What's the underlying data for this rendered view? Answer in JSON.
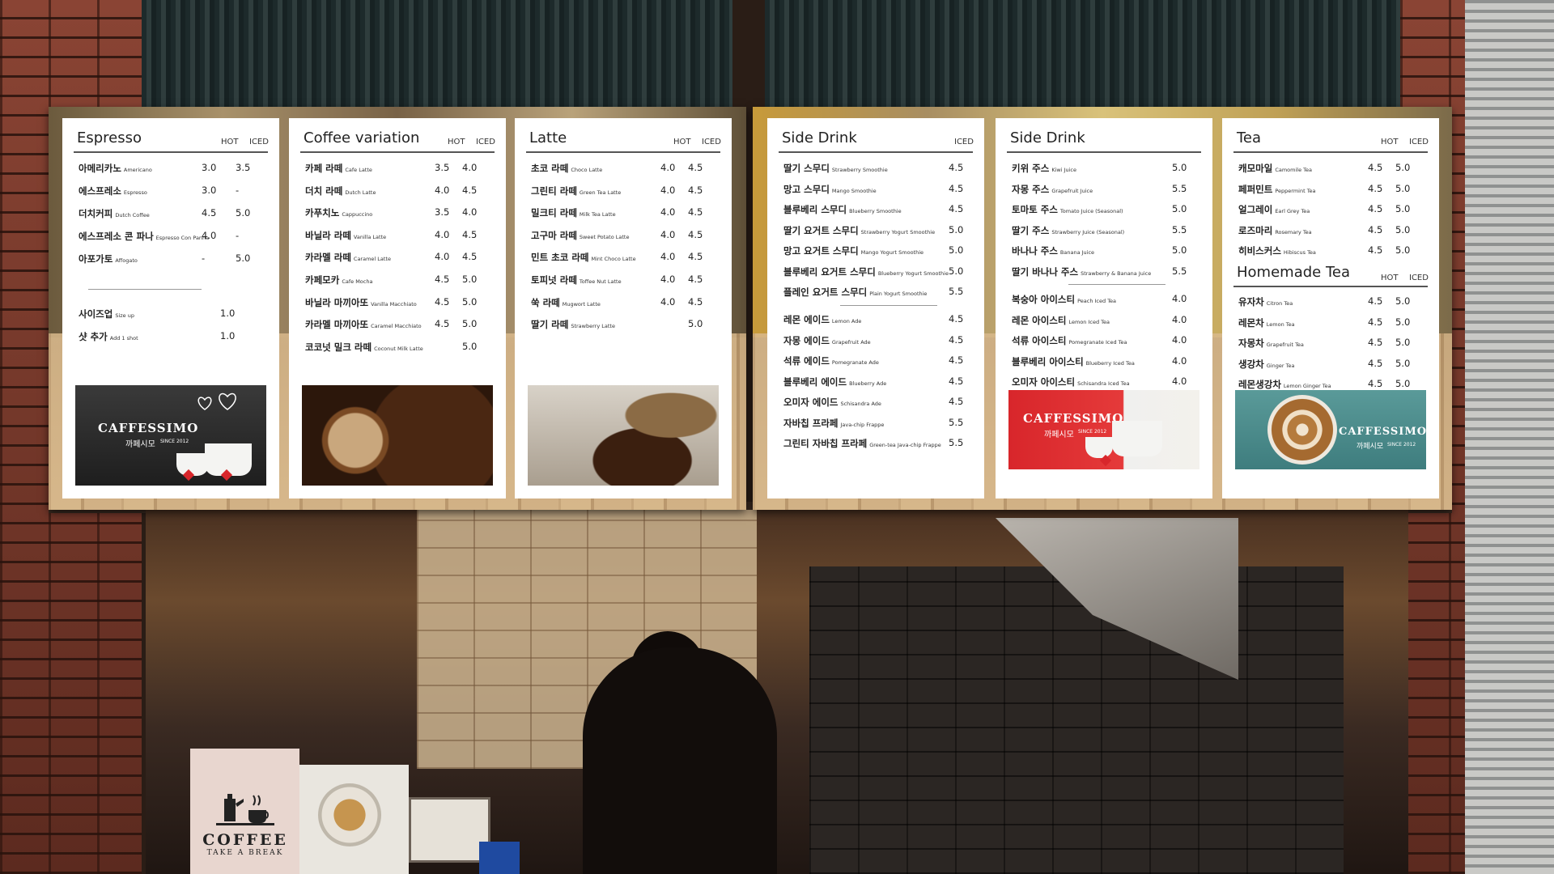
{
  "boards": {
    "left": {
      "panels": [
        {
          "title": "Espresso",
          "hot": "HOT",
          "iced": "ICED",
          "items": [
            {
              "kr": "아메리카노",
              "en": "Americano",
              "hot": "3.0",
              "iced": "3.5"
            },
            {
              "kr": "에스프레소",
              "en": "Espresso",
              "hot": "3.0",
              "iced": "-"
            },
            {
              "kr": "더치커피",
              "en": "Dutch Coffee",
              "hot": "4.5",
              "iced": "5.0"
            },
            {
              "kr": "에스프레소 콘 파나",
              "en": "Espresso Con Panna",
              "hot": "4.0",
              "iced": "-"
            },
            {
              "kr": "아포가토",
              "en": "Affogato",
              "hot": "-",
              "iced": "5.0"
            }
          ],
          "extras": [
            {
              "kr": "사이즈업",
              "en": "Size up",
              "value": "1.0"
            },
            {
              "kr": "샷 추가",
              "en": "Add 1 shot",
              "value": "1.0"
            }
          ],
          "brand": {
            "name": "CAFFESSIMO",
            "kr": "까페시모",
            "since": "SINCE 2012"
          }
        },
        {
          "title": "Coffee variation",
          "hot": "HOT",
          "iced": "ICED",
          "items": [
            {
              "kr": "카페 라떼",
              "en": "Cafe Latte",
              "hot": "3.5",
              "iced": "4.0"
            },
            {
              "kr": "더치 라떼",
              "en": "Dutch Latte",
              "hot": "4.0",
              "iced": "4.5"
            },
            {
              "kr": "카푸치노",
              "en": "Cappuccino",
              "hot": "3.5",
              "iced": "4.0"
            },
            {
              "kr": "바닐라 라떼",
              "en": "Vanilla Latte",
              "hot": "4.0",
              "iced": "4.5"
            },
            {
              "kr": "카라멜 라떼",
              "en": "Caramel Latte",
              "hot": "4.0",
              "iced": "4.5"
            },
            {
              "kr": "카페모카",
              "en": "Cafe Mocha",
              "hot": "4.5",
              "iced": "5.0"
            },
            {
              "kr": "바닐라 마끼아또",
              "en": "Vanilla Macchiato",
              "hot": "4.5",
              "iced": "5.0"
            },
            {
              "kr": "카라멜 마끼아또",
              "en": "Caramel Macchiato",
              "hot": "4.5",
              "iced": "5.0"
            },
            {
              "kr": "코코넛 밀크 라떼",
              "en": "Coconut Milk Latte",
              "hot": "",
              "iced": "5.0"
            }
          ]
        },
        {
          "title": "Latte",
          "hot": "HOT",
          "iced": "ICED",
          "items": [
            {
              "kr": "초코 라떼",
              "en": "Choco Latte",
              "hot": "4.0",
              "iced": "4.5"
            },
            {
              "kr": "그린티 라떼",
              "en": "Green Tea Latte",
              "hot": "4.0",
              "iced": "4.5"
            },
            {
              "kr": "밀크티 라떼",
              "en": "Milk Tea Latte",
              "hot": "4.0",
              "iced": "4.5"
            },
            {
              "kr": "고구마 라떼",
              "en": "Sweet Potato Latte",
              "hot": "4.0",
              "iced": "4.5"
            },
            {
              "kr": "민트 초코 라떼",
              "en": "Mint Choco Latte",
              "hot": "4.0",
              "iced": "4.5"
            },
            {
              "kr": "토피넛 라떼",
              "en": "Toffee Nut Latte",
              "hot": "4.0",
              "iced": "4.5"
            },
            {
              "kr": "쑥 라떼",
              "en": "Mugwort Latte",
              "hot": "4.0",
              "iced": "4.5"
            },
            {
              "kr": "딸기 라떼",
              "en": "Strawberry Latte",
              "hot": "",
              "iced": "5.0"
            }
          ]
        }
      ]
    },
    "right": {
      "panels": [
        {
          "title": "Side Drink",
          "iced": "ICED",
          "items": [
            {
              "kr": "딸기 스무디",
              "en": "Strawberry Smoothie",
              "iced": "4.5"
            },
            {
              "kr": "망고 스무디",
              "en": "Mango Smoothie",
              "iced": "4.5"
            },
            {
              "kr": "블루베리 스무디",
              "en": "Blueberry Smoothie",
              "iced": "4.5"
            },
            {
              "kr": "딸기 요거트 스무디",
              "en": "Strawberry Yogurt Smoothie",
              "iced": "5.0"
            },
            {
              "kr": "망고 요거트 스무디",
              "en": "Mango Yogurt Smoothie",
              "iced": "5.0"
            },
            {
              "kr": "블루베리 요거트 스무디",
              "en": "Blueberry Yogurt Smoothie",
              "iced": "5.0"
            },
            {
              "kr": "플레인 요거트 스무디",
              "en": "Plain Yogurt Smoothie",
              "iced": "5.5"
            }
          ],
          "items2": [
            {
              "kr": "레몬 에이드",
              "en": "Lemon Ade",
              "iced": "4.5"
            },
            {
              "kr": "자몽 에이드",
              "en": "Grapefruit Ade",
              "iced": "4.5"
            },
            {
              "kr": "석류 에이드",
              "en": "Pomegranate Ade",
              "iced": "4.5"
            },
            {
              "kr": "블루베리 에이드",
              "en": "Blueberry Ade",
              "iced": "4.5"
            },
            {
              "kr": "오미자 에이드",
              "en": "Schisandra Ade",
              "iced": "4.5"
            },
            {
              "kr": "자바칩 프라페",
              "en": "Java-chip Frappe",
              "iced": "5.5"
            },
            {
              "kr": "그린티 자바칩 프라페",
              "en": "Green-tea Java-chip Frappe",
              "iced": "5.5"
            }
          ]
        },
        {
          "title": "Side Drink",
          "items": [
            {
              "kr": "키위 주스",
              "en": "Kiwi Juice",
              "iced": "5.0"
            },
            {
              "kr": "자몽 주스",
              "en": "Grapefruit Juice",
              "iced": "5.5"
            },
            {
              "kr": "토마토 주스",
              "en": "Tomato Juice (Seasonal)",
              "iced": "5.0"
            },
            {
              "kr": "딸기 주스",
              "en": "Strawberry Juice (Seasonal)",
              "iced": "5.5"
            },
            {
              "kr": "바나나 주스",
              "en": "Banana Juice",
              "iced": "5.0"
            },
            {
              "kr": "딸기 바나나 주스",
              "en": "Strawberry & Banana Juice",
              "iced": "5.5"
            }
          ],
          "items2": [
            {
              "kr": "복숭아 아이스티",
              "en": "Peach Iced Tea",
              "iced": "4.0"
            },
            {
              "kr": "레몬 아이스티",
              "en": "Lemon Iced Tea",
              "iced": "4.0"
            },
            {
              "kr": "석류 아이스티",
              "en": "Pomegranate Iced Tea",
              "iced": "4.0"
            },
            {
              "kr": "블루베리 아이스티",
              "en": "Blueberry Iced Tea",
              "iced": "4.0"
            },
            {
              "kr": "오미자 아이스티",
              "en": "Schisandra Iced Tea",
              "iced": "4.0"
            }
          ],
          "brand": {
            "name": "CAFFESSIMO",
            "kr": "까페시모",
            "since": "SINCE 2012"
          }
        },
        {
          "title": "Tea",
          "hot": "HOT",
          "iced": "ICED",
          "items": [
            {
              "kr": "캐모마일",
              "en": "Camomile Tea",
              "hot": "4.5",
              "iced": "5.0"
            },
            {
              "kr": "페퍼민트",
              "en": "Peppermint Tea",
              "hot": "4.5",
              "iced": "5.0"
            },
            {
              "kr": "얼그레이",
              "en": "Earl Grey Tea",
              "hot": "4.5",
              "iced": "5.0"
            },
            {
              "kr": "로즈마리",
              "en": "Rosemary Tea",
              "hot": "4.5",
              "iced": "5.0"
            },
            {
              "kr": "히비스커스",
              "en": "Hibiscus Tea",
              "hot": "4.5",
              "iced": "5.0"
            }
          ],
          "title2": "Homemade Tea",
          "items2": [
            {
              "kr": "유자차",
              "en": "Citron Tea",
              "hot": "4.5",
              "iced": "5.0"
            },
            {
              "kr": "레몬차",
              "en": "Lemon Tea",
              "hot": "4.5",
              "iced": "5.0"
            },
            {
              "kr": "자몽차",
              "en": "Grapefruit Tea",
              "hot": "4.5",
              "iced": "5.0"
            },
            {
              "kr": "생강차",
              "en": "Ginger Tea",
              "hot": "4.5",
              "iced": "5.0"
            },
            {
              "kr": "레몬생강차",
              "en": "Lemon Ginger Tea",
              "hot": "4.5",
              "iced": "5.0"
            }
          ],
          "brand": {
            "name": "CAFFESSIMO",
            "kr": "까페시모",
            "since": "SINCE 2012"
          }
        }
      ]
    }
  },
  "counter_sign": {
    "title": "COFFEE",
    "subtitle": "TAKE A BREAK"
  },
  "colors": {
    "panel_bg": "#ffffff",
    "brand_red": "#d8262b",
    "brand_teal": "#3e7d7e",
    "text": "#222222"
  }
}
